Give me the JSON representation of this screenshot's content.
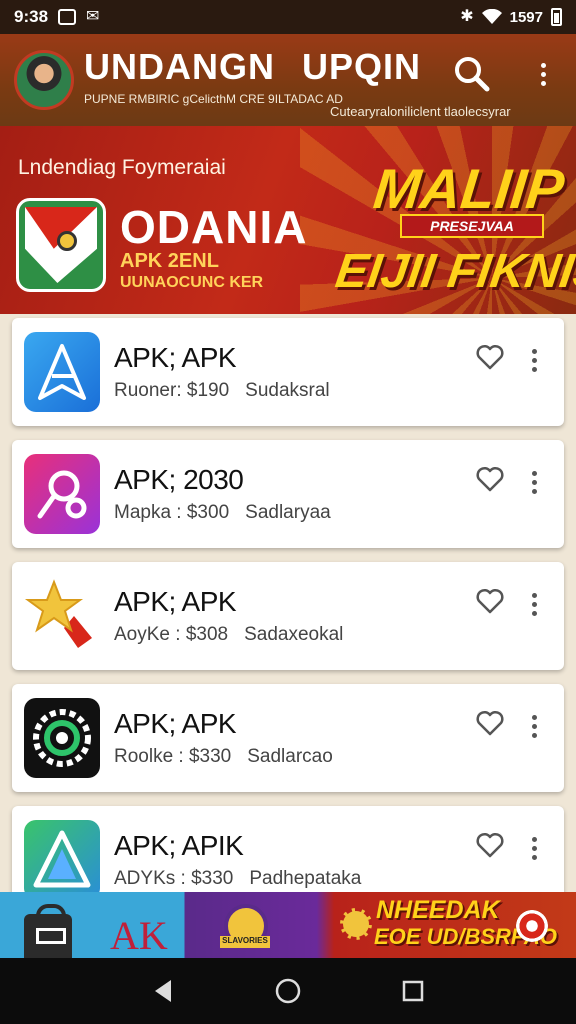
{
  "status_bar": {
    "time": "9:38",
    "battery_text": "1597",
    "icons": [
      "screenshot-icon",
      "messenger-icon",
      "bluetooth-icon",
      "wifi-icon",
      "battery-icon"
    ]
  },
  "app_bar": {
    "title_1": "UNDANGN",
    "title_2": "UPQIN",
    "subtitle_1": "PUPNE RMBIRIC gCelicthM CRE 9ILTADAC AD",
    "subtitle_2": "Cutearyraloniliclent tlaolecsyrar"
  },
  "banner": {
    "header": "Lndendiag Foymeraiai",
    "title": "ODANIA",
    "sub1": "APK 2ENL",
    "sub2": "UUNAOCUNC KER",
    "promo_1": "MALIIP",
    "promo_box": "PRESEJVAA",
    "promo_2": "EIJII FIKNIS!"
  },
  "apps": [
    {
      "name": "APK; APK",
      "meta_1": "Ruoner: $190",
      "meta_2": "Sudaksral",
      "icon": "app-icon-blue"
    },
    {
      "name": "APK; 2030",
      "meta_1": "Mapka : $300",
      "meta_2": "Sadlaryaa",
      "icon": "app-icon-pink"
    },
    {
      "name": "APK; APK",
      "meta_1": "AoyKe : $308",
      "meta_2": "Sadaxeokal",
      "icon": "app-icon-star"
    },
    {
      "name": "APK; APK",
      "meta_1": "Roolke : $330",
      "meta_2": "Sadlarcao",
      "icon": "app-icon-green-circle"
    },
    {
      "name": "APK; APIK",
      "meta_1": "ADYKs : $330",
      "meta_2": "Padhepataka",
      "icon": "app-icon-blue-a"
    }
  ],
  "bottom_banner": {
    "ak_text": "AK",
    "badge_label": "SLAVORIES",
    "promo_1": "NHEEDAK",
    "promo_2": "EOE UD/BSRPAO"
  },
  "colors": {
    "app_bar": "#7a3a12",
    "banner_red": "#c22a18",
    "promo_yellow": "#ffd21a"
  }
}
